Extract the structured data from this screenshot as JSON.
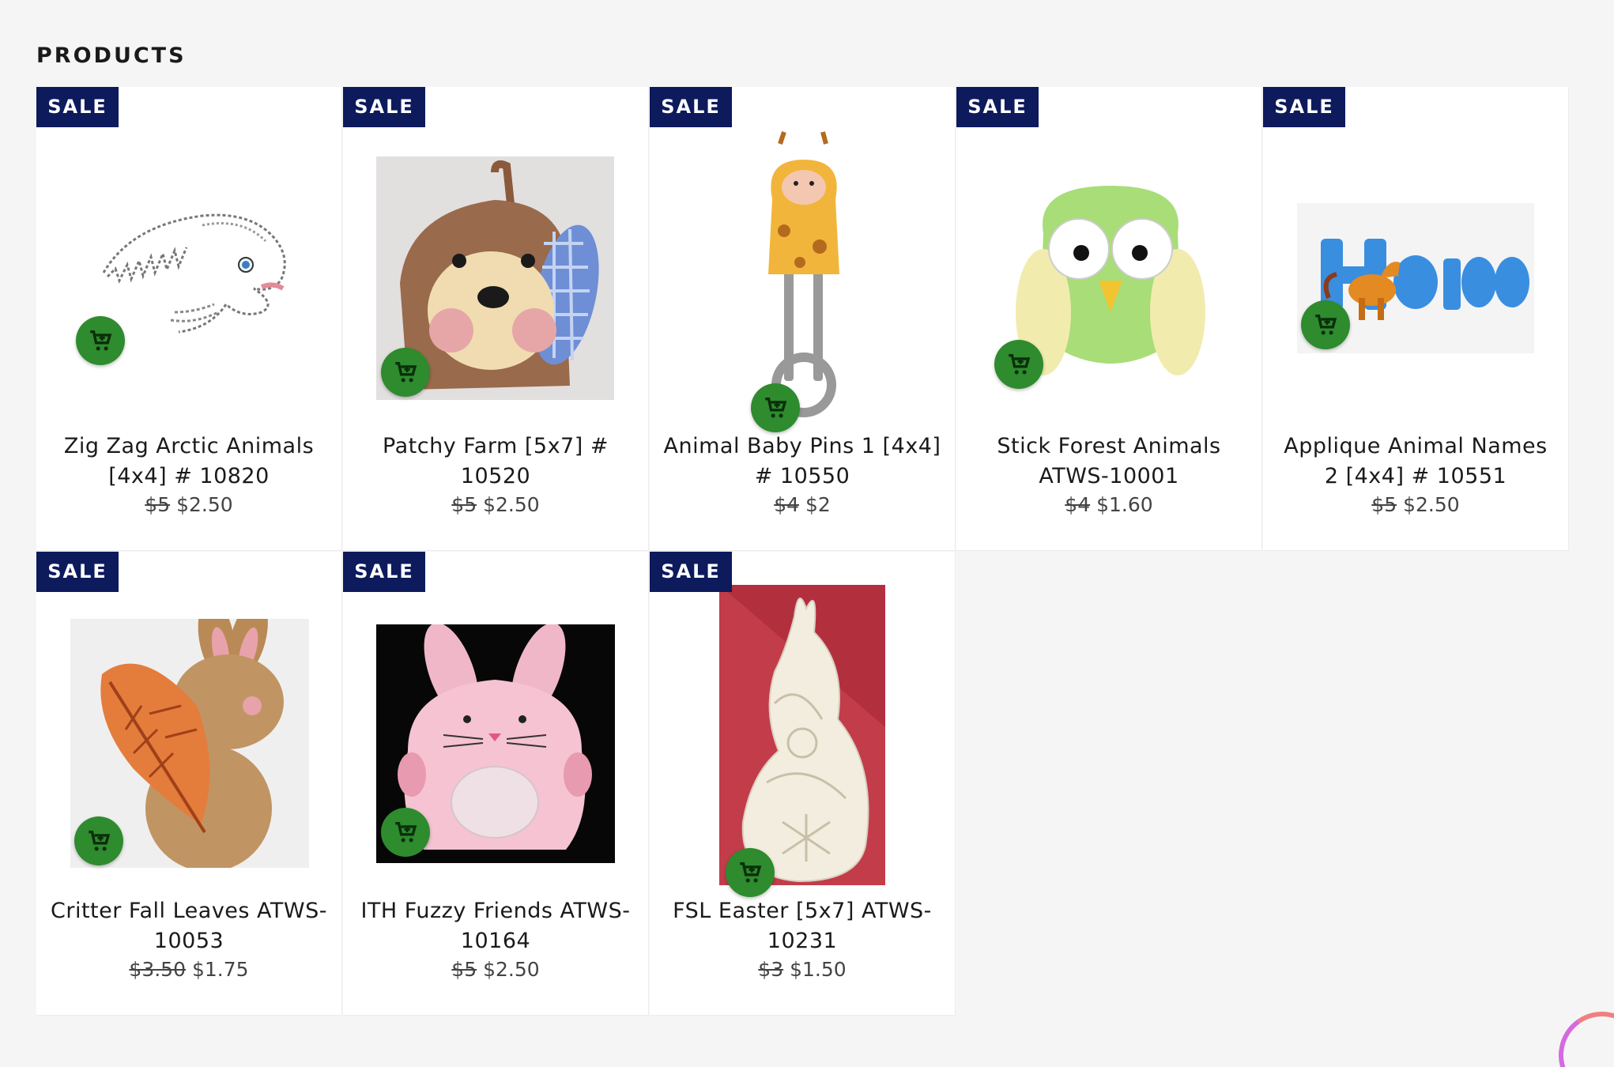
{
  "section_title": "PRODUCTS",
  "sale_label": "SALE",
  "products": [
    {
      "title": "Zig Zag Arctic Animals [4x4] # 10820",
      "old_price": "$5",
      "price": "$2.50"
    },
    {
      "title": "Patchy Farm [5x7] # 10520",
      "old_price": "$5",
      "price": "$2.50"
    },
    {
      "title": "Animal Baby Pins 1 [4x4] # 10550",
      "old_price": "$4",
      "price": "$2"
    },
    {
      "title": "Stick Forest Animals ATWS-10001",
      "old_price": "$4",
      "price": "$1.60"
    },
    {
      "title": "Applique Animal Names 2 [4x4] # 10551",
      "old_price": "$5",
      "price": "$2.50"
    },
    {
      "title": "Critter Fall Leaves ATWS-10053",
      "old_price": "$3.50",
      "price": "$1.75"
    },
    {
      "title": "ITH Fuzzy Friends ATWS-10164",
      "old_price": "$5",
      "price": "$2.50"
    },
    {
      "title": "FSL Easter [5x7] ATWS-10231",
      "old_price": "$3",
      "price": "$1.50"
    }
  ],
  "icons": {
    "cart": "add-to-cart-icon"
  },
  "colors": {
    "sale_badge": "#0d1a5c",
    "cart_button": "#2e8b2e",
    "page_bg": "#f5f5f5"
  }
}
